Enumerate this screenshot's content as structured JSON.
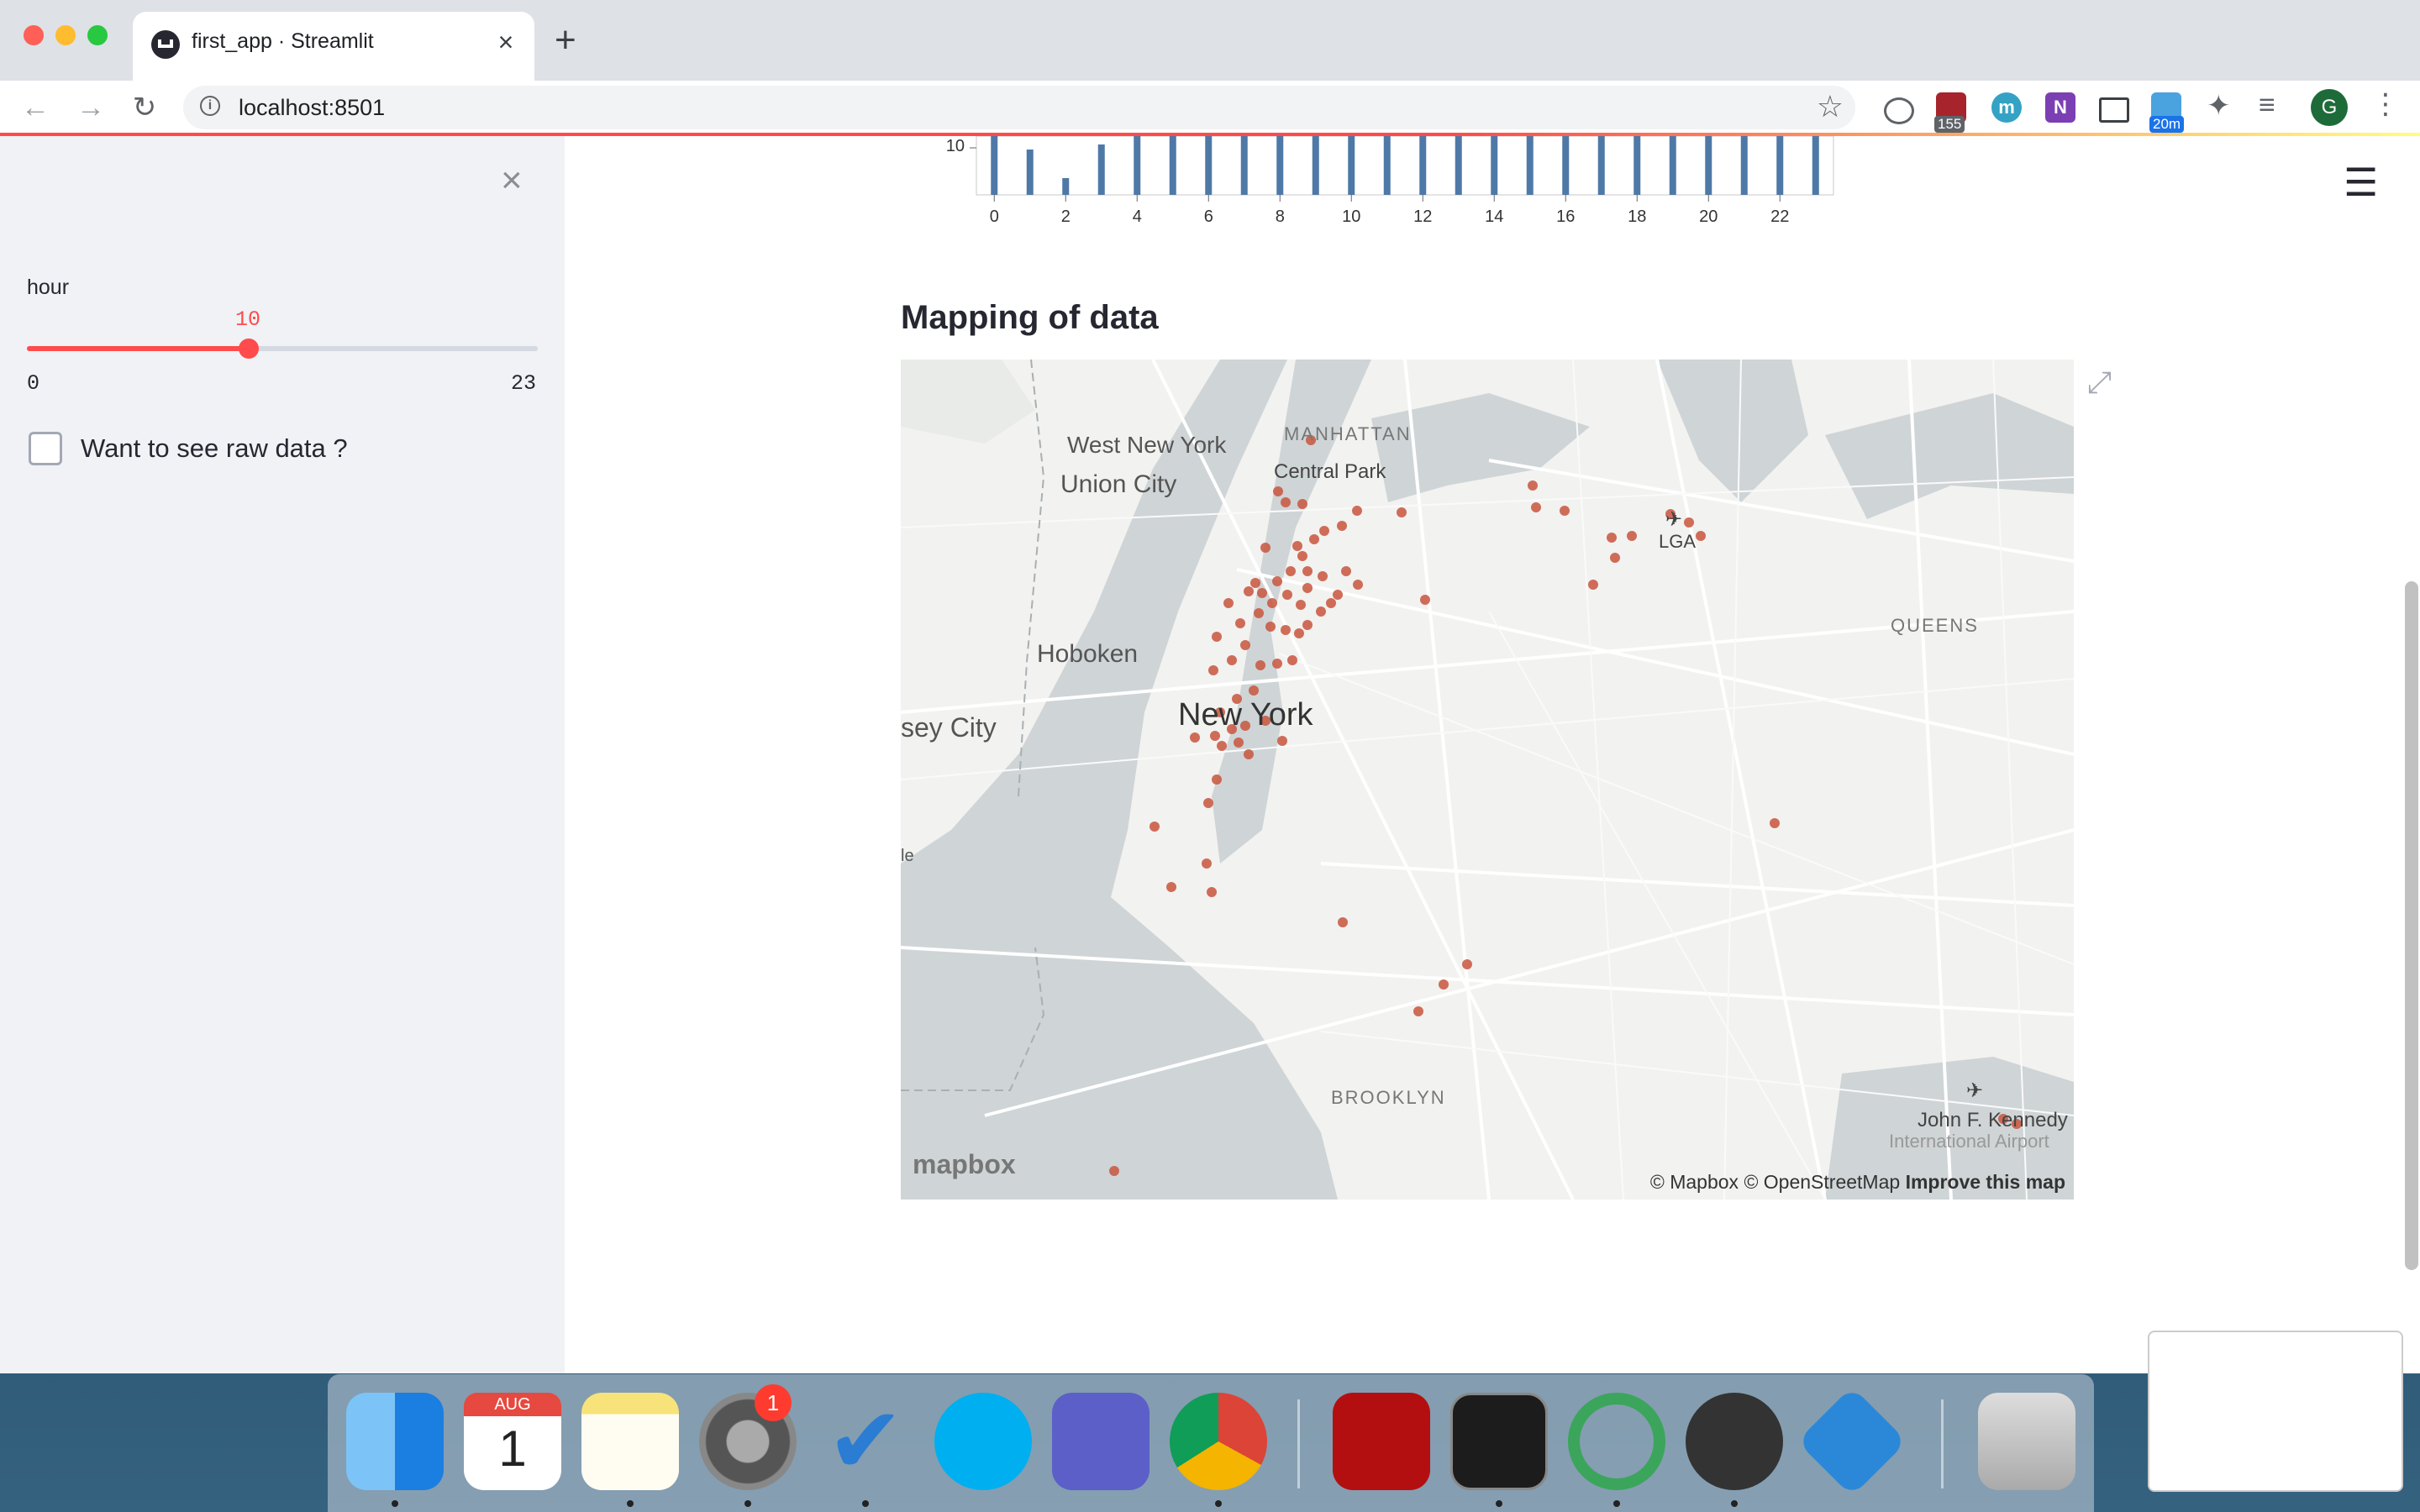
{
  "browser": {
    "tab_title": "first_app · Streamlit",
    "tab_close": "×",
    "new_tab": "+",
    "url": "localhost:8501",
    "extensions": {
      "badge_count": "155",
      "m_label": "m",
      "n_label": "N",
      "timer_badge": "20m",
      "avatar_letter": "G"
    }
  },
  "sidebar": {
    "close": "×",
    "slider": {
      "label": "hour",
      "value": 10,
      "value_text": "10",
      "min": "0",
      "max": "23"
    },
    "checkbox": {
      "label": "Want to see raw data ?",
      "checked": false
    }
  },
  "main": {
    "menu_icon": "☰",
    "section_title": "Mapping of data"
  },
  "chart_data": {
    "type": "bar",
    "ytick_visible": "10",
    "xticks": [
      "0",
      "2",
      "4",
      "6",
      "8",
      "10",
      "12",
      "14",
      "16",
      "18",
      "20",
      "22"
    ],
    "note_clipped": true,
    "categories": [
      0,
      1,
      2,
      3,
      4,
      5,
      6,
      7,
      8,
      9,
      10,
      11,
      12,
      13,
      14,
      15,
      16,
      17,
      18,
      19,
      20,
      21,
      22,
      23
    ],
    "values": [
      13,
      11.2,
      9.5,
      11.5,
      13,
      13,
      13,
      13,
      13,
      13,
      13,
      13,
      13,
      13,
      13,
      13,
      13,
      13,
      13,
      13,
      13,
      13,
      13,
      13
    ],
    "color": "#4e79a7"
  },
  "map": {
    "labels": {
      "manhattan": "MANHATTAN",
      "central_park": "Central Park",
      "west_new_york": "West New York",
      "union_city": "Union City",
      "hoboken": "Hoboken",
      "new_york": "New York",
      "jersey_city": "sey City",
      "queens": "QUEENS",
      "brooklyn": "BROOKLYN",
      "lga": "LGA",
      "jfk": "John F. Kennedy",
      "jfk_sub": "International Airport",
      "edge_le": "le"
    },
    "logo": "mapbox",
    "attribution_mapbox": "© Mapbox",
    "attribution_osm": "© OpenStreetMap",
    "improve": "Improve this map",
    "point_color": "#c8553d"
  },
  "dock": {
    "calendar_month": "AUG",
    "calendar_day": "1",
    "settings_badge": "1"
  }
}
